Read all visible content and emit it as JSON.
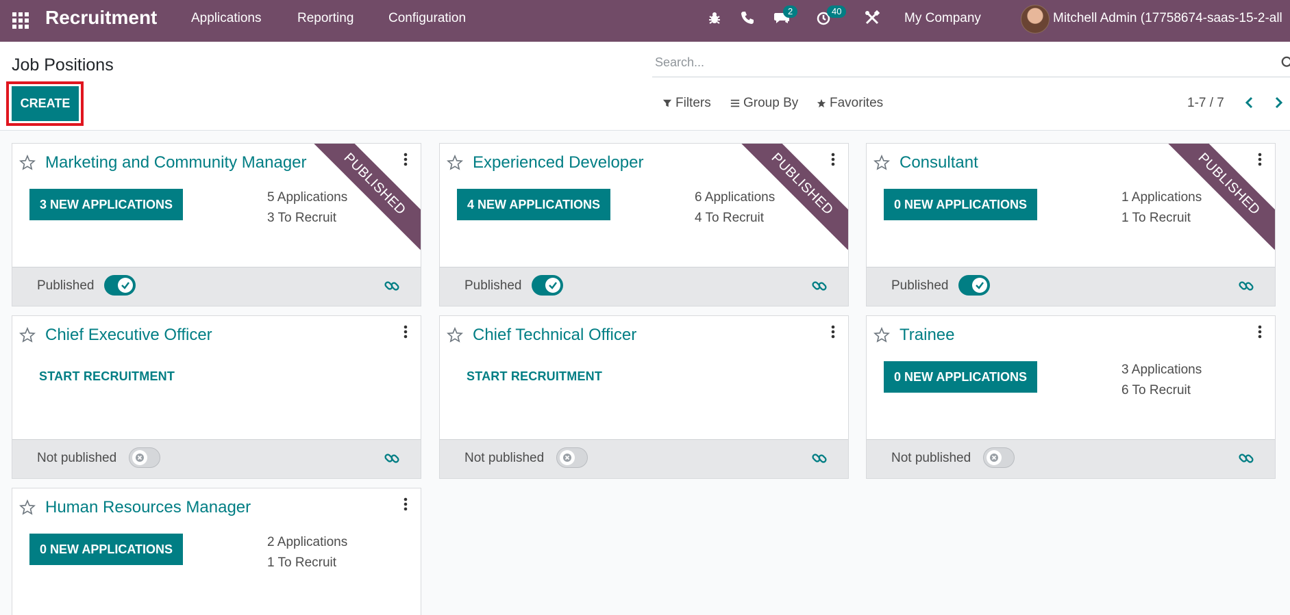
{
  "navbar": {
    "brand": "Recruitment",
    "menus": [
      "Applications",
      "Reporting",
      "Configuration"
    ],
    "messages_badge": "2",
    "activities_badge": "40",
    "company": "My Company",
    "user": "Mitchell Admin (17758674-saas-15-2-all"
  },
  "control": {
    "title": "Job Positions",
    "create_label": "CREATE",
    "search_placeholder": "Search...",
    "filters_label": "Filters",
    "groupby_label": "Group By",
    "favorites_label": "Favorites",
    "pager": "1-7 / 7"
  },
  "cards": [
    {
      "title": "Marketing and Community Manager",
      "new_apps": "3 NEW APPLICATIONS",
      "applications": "5 Applications",
      "to_recruit": "3 To Recruit",
      "ribbon": "PUBLISHED",
      "status": "Published"
    },
    {
      "title": "Experienced Developer",
      "new_apps": "4 NEW APPLICATIONS",
      "applications": "6 Applications",
      "to_recruit": "4 To Recruit",
      "ribbon": "PUBLISHED",
      "status": "Published"
    },
    {
      "title": "Consultant",
      "new_apps": "0 NEW APPLICATIONS",
      "applications": "1 Applications",
      "to_recruit": "1 To Recruit",
      "ribbon": "PUBLISHED",
      "status": "Published"
    },
    {
      "title": "Chief Executive Officer",
      "start": "START RECRUITMENT",
      "status": "Not published"
    },
    {
      "title": "Chief Technical Officer",
      "start": "START RECRUITMENT",
      "status": "Not published"
    },
    {
      "title": "Trainee",
      "new_apps": "0 NEW APPLICATIONS",
      "applications": "3 Applications",
      "to_recruit": "6 To Recruit",
      "status": "Not published"
    },
    {
      "title": "Human Resources Manager",
      "new_apps": "0 NEW APPLICATIONS",
      "applications": "2 Applications",
      "to_recruit": "1 To Recruit"
    }
  ],
  "colors": {
    "navbar": "#714b67",
    "accent": "#017e84",
    "highlight": "#e0161f"
  }
}
